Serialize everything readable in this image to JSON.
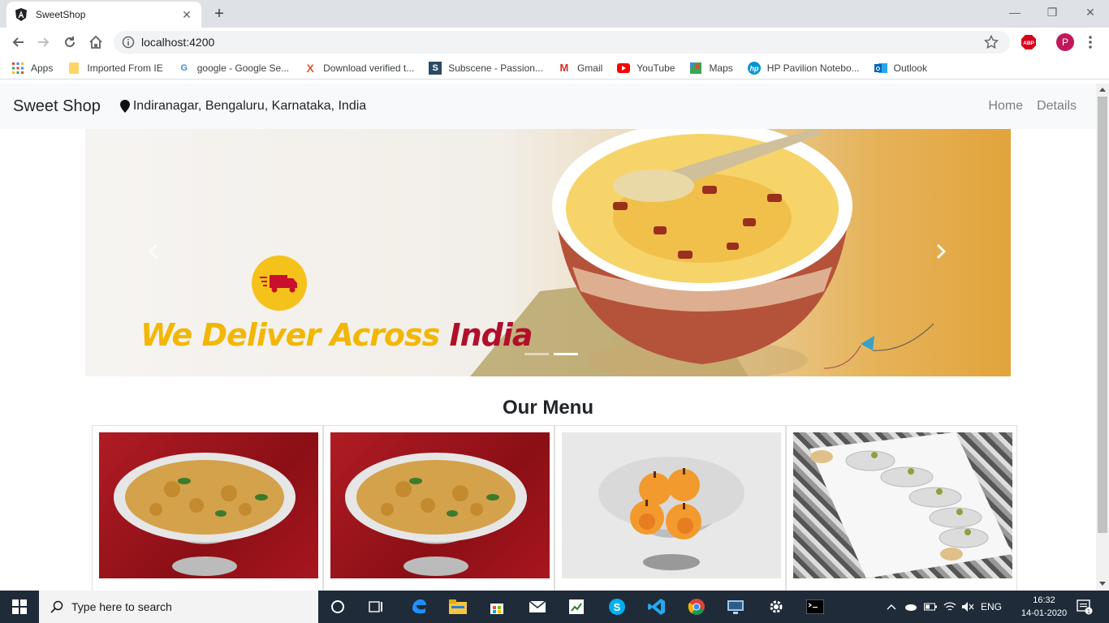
{
  "browser": {
    "tab_title": "SweetShop",
    "url": "localhost:4200",
    "profile_initial": "P",
    "abp_label": "ABP"
  },
  "bookmarks": [
    {
      "label": "Apps",
      "icon": "apps-grid-icon"
    },
    {
      "label": "Imported From IE",
      "icon": "folder-icon"
    },
    {
      "label": "google - Google Se...",
      "icon": "google-icon"
    },
    {
      "label": "Download verified t...",
      "icon": "x-icon"
    },
    {
      "label": "Subscene - Passion...",
      "icon": "subscene-icon"
    },
    {
      "label": "Gmail",
      "icon": "gmail-icon"
    },
    {
      "label": "YouTube",
      "icon": "youtube-icon"
    },
    {
      "label": "Maps",
      "icon": "maps-icon"
    },
    {
      "label": "HP Pavilion Notebo...",
      "icon": "hp-icon"
    },
    {
      "label": "Outlook",
      "icon": "outlook-icon"
    }
  ],
  "site": {
    "brand": "Sweet Shop",
    "location": "Indiranagar, Bengaluru, Karnataka, India",
    "nav": [
      "Home",
      "Details"
    ]
  },
  "carousel": {
    "banner_text_a": "We Deliver Across",
    "banner_text_b": "India",
    "slide_count": 2,
    "active_slide": 2
  },
  "menu": {
    "title": "Our Menu",
    "items": [
      {
        "image": "mixture-namkeen-bowl"
      },
      {
        "image": "mixture-namkeen-bowl"
      },
      {
        "image": "orange-peda-bowl"
      },
      {
        "image": "kaju-sweets-tray"
      }
    ]
  },
  "taskbar": {
    "search_placeholder": "Type here to search",
    "language": "ENG",
    "time": "16:32",
    "date": "14-01-2020",
    "notification_count": "1"
  }
}
